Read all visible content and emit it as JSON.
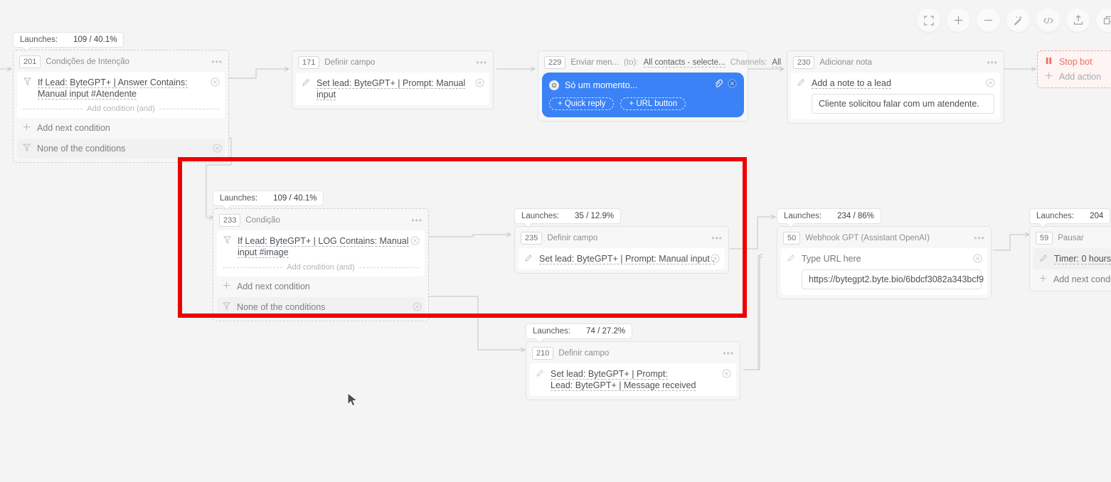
{
  "canvas": {
    "background": "#f4f4f4",
    "highlight_color": "#ee0000"
  },
  "toolbar": {
    "buttons": [
      {
        "name": "fullscreen-button",
        "label": "Fullscreen"
      },
      {
        "name": "zoom-in-button",
        "label": "Zoom in"
      },
      {
        "name": "zoom-out-button",
        "label": "Zoom out"
      },
      {
        "name": "magic-wand-button",
        "label": "Auto arrange"
      },
      {
        "name": "code-button",
        "label": "Code"
      },
      {
        "name": "share-button",
        "label": "Share"
      },
      {
        "name": "extra-button",
        "label": "More"
      }
    ]
  },
  "labels": {
    "launches": "Launches:",
    "add_condition_and": "Add condition (and)",
    "add_next_condition": "Add next condition",
    "none_of_conditions": "None of the conditions",
    "add_action": "Add action",
    "stop_bot": "Stop bot"
  },
  "nodes": {
    "n201": {
      "id": "201",
      "title": "Condições de Intenção",
      "launches": {
        "label": "Launches:",
        "value": "109 / 40.1%"
      },
      "condition": "If Lead: ByteGPT+ | Answer Contains: Manual input #Atendente"
    },
    "n171": {
      "id": "171",
      "title": "Definir campo",
      "action": "Set lead: ByteGPT+ | Prompt: Manual input"
    },
    "n229": {
      "id": "229",
      "title": "Enviar men...",
      "to_label": "(to):",
      "to_value": "All contacts - selecte...",
      "channels_label": "Channels:",
      "channels_value": "All",
      "message": "Só um momento...",
      "quick_reply": "+ Quick reply",
      "url_button": "+ URL button"
    },
    "n230": {
      "id": "230",
      "title": "Adicionar nota",
      "action": "Add a note to a lead",
      "note": "Cliente solicitou falar com um atendente."
    },
    "n233": {
      "id": "233",
      "title": "Condição",
      "launches": {
        "label": "Launches:",
        "value": "109 / 40.1%"
      },
      "condition": "If Lead: ByteGPT+ | LOG Contains: Manual input #image"
    },
    "n235": {
      "id": "235",
      "title": "Definir campo",
      "launches": {
        "label": "Launches:",
        "value": "35 / 12.9%"
      },
      "action": "Set lead: ByteGPT+ | Prompt: Manual input ."
    },
    "n50": {
      "id": "50",
      "title": "Webhook GPT (Assistant OpenAI)",
      "launches": {
        "label": "Launches:",
        "value": "234 / 86%"
      },
      "action": "Type URL here",
      "url": "https://bytegpt2.byte.bio/6bdcf3082a343bcf9"
    },
    "n59": {
      "id": "59",
      "title": "Pausar",
      "launches": {
        "label": "Launches:",
        "value": "204"
      },
      "timer_label": "Timer:",
      "timer_value": "0 hours",
      "add_next_condition": "Add next condition"
    },
    "n210": {
      "id": "210",
      "title": "Definir campo",
      "launches": {
        "label": "Launches:",
        "value": "74 / 27.2%"
      },
      "action_line1": "Set lead: ByteGPT+ | Prompt:",
      "action_line2": "Lead: ByteGPT+ | Message received"
    }
  }
}
